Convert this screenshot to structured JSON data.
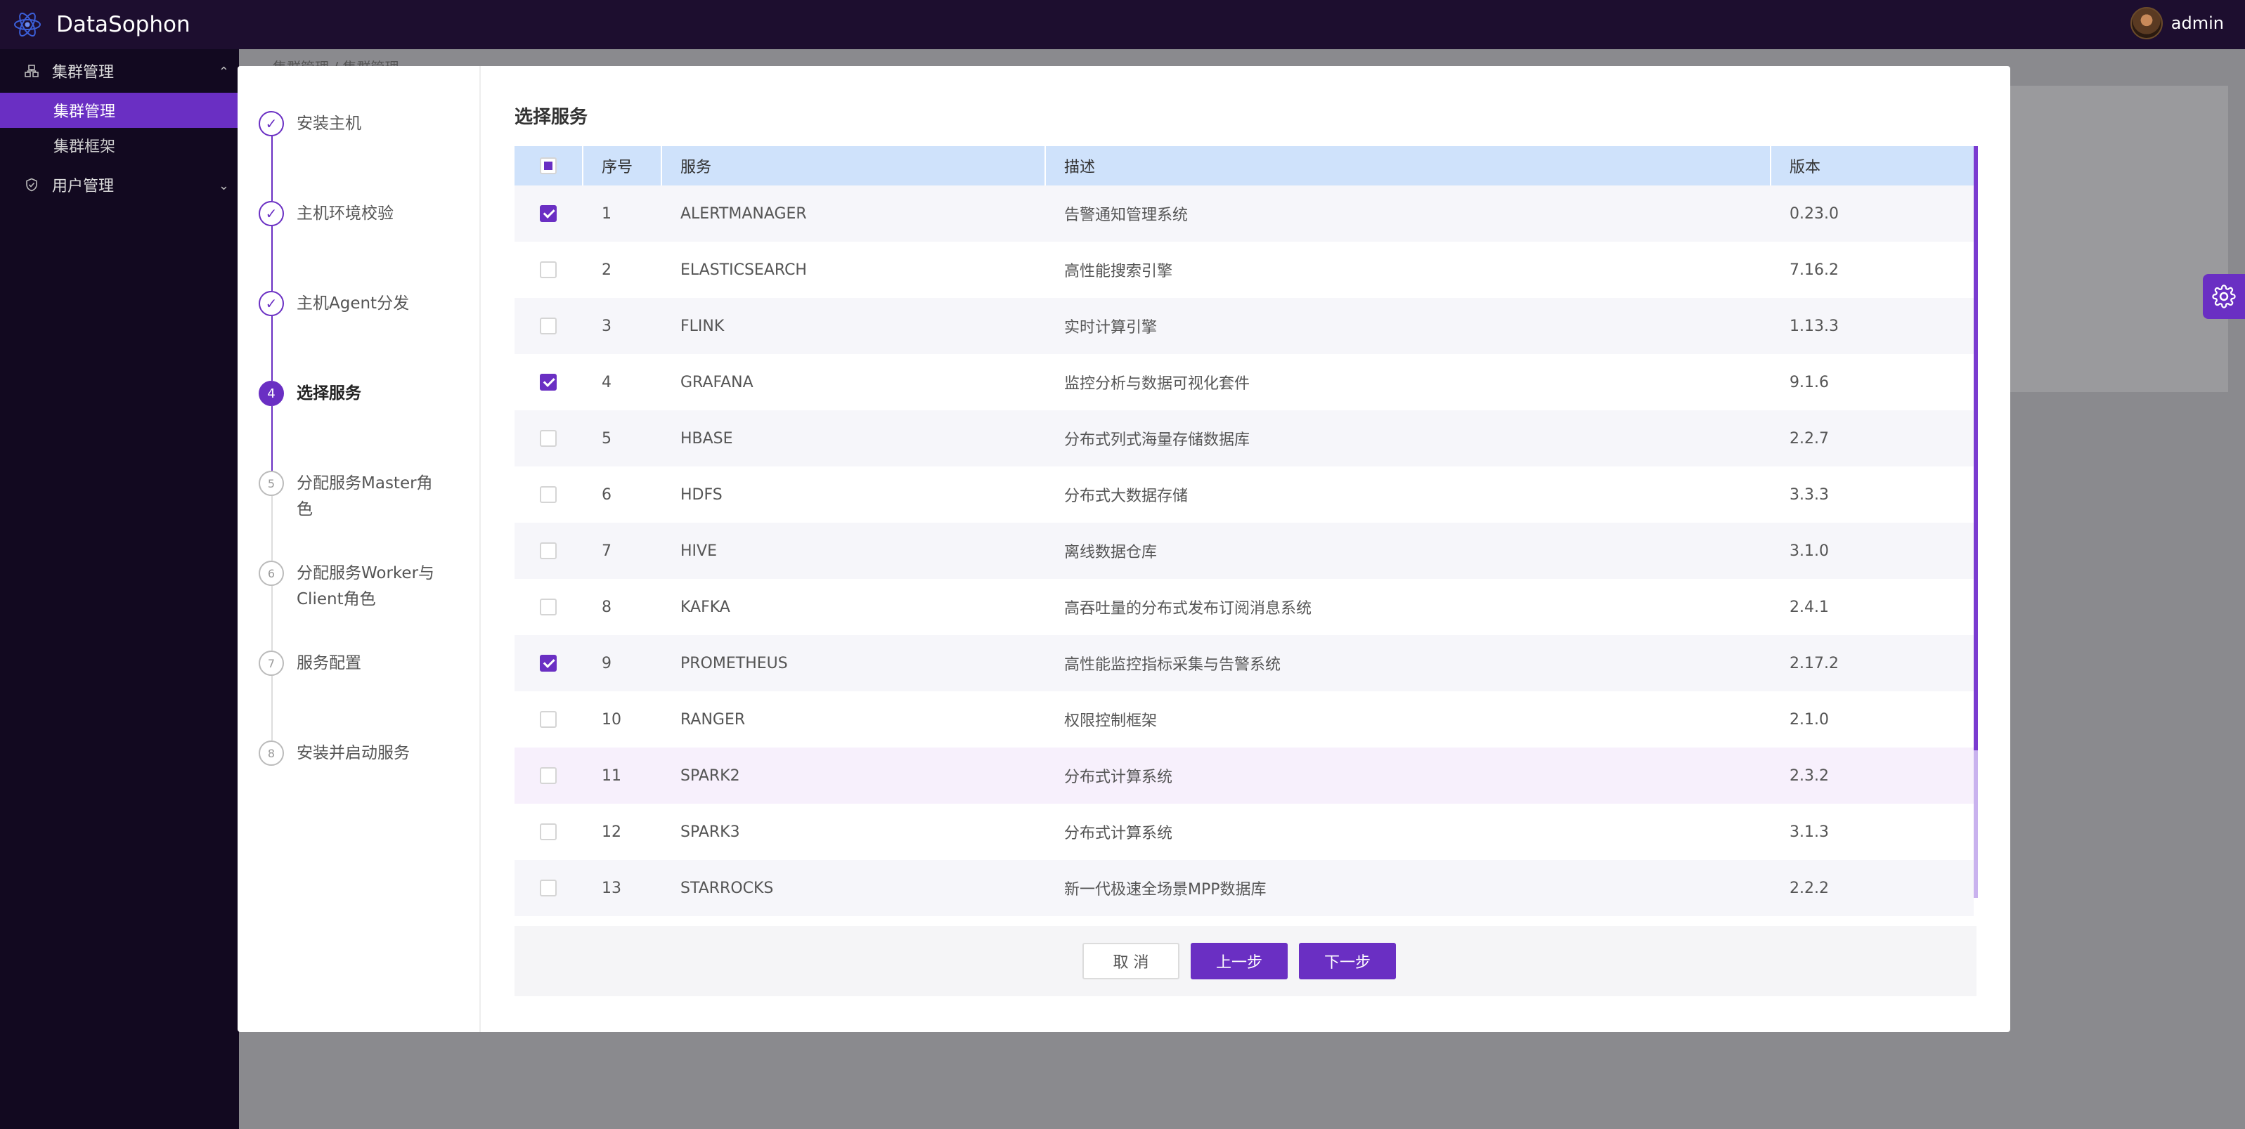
{
  "app": {
    "name": "DataSophon",
    "user": "admin"
  },
  "sidebar": {
    "groups": [
      {
        "label": "集群管理",
        "items": [
          {
            "label": "集群管理",
            "active": true
          },
          {
            "label": "集群框架",
            "active": false
          }
        ]
      },
      {
        "label": "用户管理"
      }
    ]
  },
  "breadcrumb": "集群管理 / 集群管理",
  "wizard": {
    "steps": [
      {
        "num": "1",
        "label": "安装主机",
        "state": "done"
      },
      {
        "num": "2",
        "label": "主机环境校验",
        "state": "done"
      },
      {
        "num": "3",
        "label": "主机Agent分发",
        "state": "done"
      },
      {
        "num": "4",
        "label": "选择服务",
        "state": "current"
      },
      {
        "num": "5",
        "label": "分配服务Master角色",
        "state": "pending"
      },
      {
        "num": "6",
        "label": "分配服务Worker与Client角色",
        "state": "pending"
      },
      {
        "num": "7",
        "label": "服务配置",
        "state": "pending"
      },
      {
        "num": "8",
        "label": "安装并启动服务",
        "state": "pending"
      }
    ],
    "panel_title": "选择服务",
    "table": {
      "headers": {
        "index": "序号",
        "service": "服务",
        "description": "描述",
        "version": "版本"
      },
      "rows": [
        {
          "index": "1",
          "service": "ALERTMANAGER",
          "description": "告警通知管理系统",
          "version": "0.23.0",
          "checked": true
        },
        {
          "index": "2",
          "service": "ELASTICSEARCH",
          "description": "高性能搜索引擎",
          "version": "7.16.2",
          "checked": false
        },
        {
          "index": "3",
          "service": "FLINK",
          "description": "实时计算引擎",
          "version": "1.13.3",
          "checked": false
        },
        {
          "index": "4",
          "service": "GRAFANA",
          "description": "监控分析与数据可视化套件",
          "version": "9.1.6",
          "checked": true
        },
        {
          "index": "5",
          "service": "HBASE",
          "description": "分布式列式海量存储数据库",
          "version": "2.2.7",
          "checked": false
        },
        {
          "index": "6",
          "service": "HDFS",
          "description": "分布式大数据存储",
          "version": "3.3.3",
          "checked": false
        },
        {
          "index": "7",
          "service": "HIVE",
          "description": "离线数据仓库",
          "version": "3.1.0",
          "checked": false
        },
        {
          "index": "8",
          "service": "KAFKA",
          "description": "高吞吐量的分布式发布订阅消息系统",
          "version": "2.4.1",
          "checked": false
        },
        {
          "index": "9",
          "service": "PROMETHEUS",
          "description": "高性能监控指标采集与告警系统",
          "version": "2.17.2",
          "checked": true
        },
        {
          "index": "10",
          "service": "RANGER",
          "description": "权限控制框架",
          "version": "2.1.0",
          "checked": false
        },
        {
          "index": "11",
          "service": "SPARK2",
          "description": "分布式计算系统",
          "version": "2.3.2",
          "checked": false
        },
        {
          "index": "12",
          "service": "SPARK3",
          "description": "分布式计算系统",
          "version": "3.1.3",
          "checked": false
        },
        {
          "index": "13",
          "service": "STARROCKS",
          "description": "新一代极速全场景MPP数据库",
          "version": "2.2.2",
          "checked": false
        }
      ]
    },
    "buttons": {
      "cancel": "取 消",
      "prev": "上一步",
      "next": "下一步"
    }
  },
  "colors": {
    "accent": "#6a2fc3",
    "header_bg": "#1d0e2f",
    "table_header": "#cfe2fb"
  }
}
